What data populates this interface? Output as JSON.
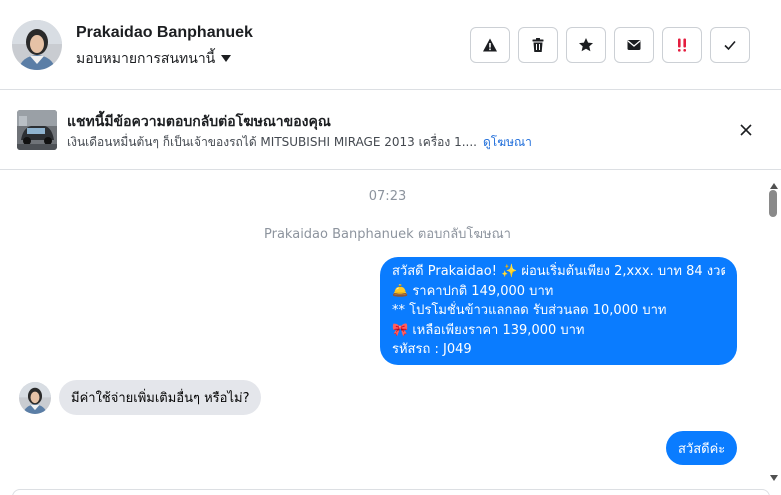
{
  "contact": {
    "name": "Prakaidao Banphanuek",
    "assign_label": "มอบหมายการสนทนานี้"
  },
  "actions": [
    {
      "name": "warning-icon"
    },
    {
      "name": "trash-icon"
    },
    {
      "name": "star-icon"
    },
    {
      "name": "envelope-icon"
    },
    {
      "name": "double-exclamation-icon"
    },
    {
      "name": "checkmark-icon"
    }
  ],
  "banner": {
    "title": "แชทนี้มีข้อความตอบกลับต่อโฆษณาของคุณ",
    "subtitle": "เงินเดือนหมื่นต้นๆ ก็เป็นเจ้าของรถได้ MITSUBISHI MIRAGE 2013 เครื่อง 1....",
    "link": "ดูโฆษณา"
  },
  "thread": {
    "timestamp": "07:23",
    "note": "Prakaidao Banphanuek ตอบกลับโฆษณา",
    "outgoing_message_lines": [
      "สวัสดี Prakaidao! ✨  ผ่อนเริ่มต้นเพียง 2,xxx. บาท 84 งวด",
      "🛎️ ราคาปกติ 149,000 บาท",
      "** โปรโมชั่นข้าวแลกลด รับส่วนลด 10,000 บาท",
      "🎀  เหลือเพียงราคา 139,000 บาท",
      " รหัสรถ : J049"
    ],
    "incoming_message": "มีค่าใช้จ่ายเพิ่มเติมอื่นๆ หรือไม่?",
    "outgoing_reply": "สวัสดีค่ะ"
  },
  "colors": {
    "outgoing_bubble": "#0a7cff",
    "incoming_bubble": "#e4e6eb",
    "link": "#216fdb",
    "exclamation_red": "#e41e3f"
  }
}
